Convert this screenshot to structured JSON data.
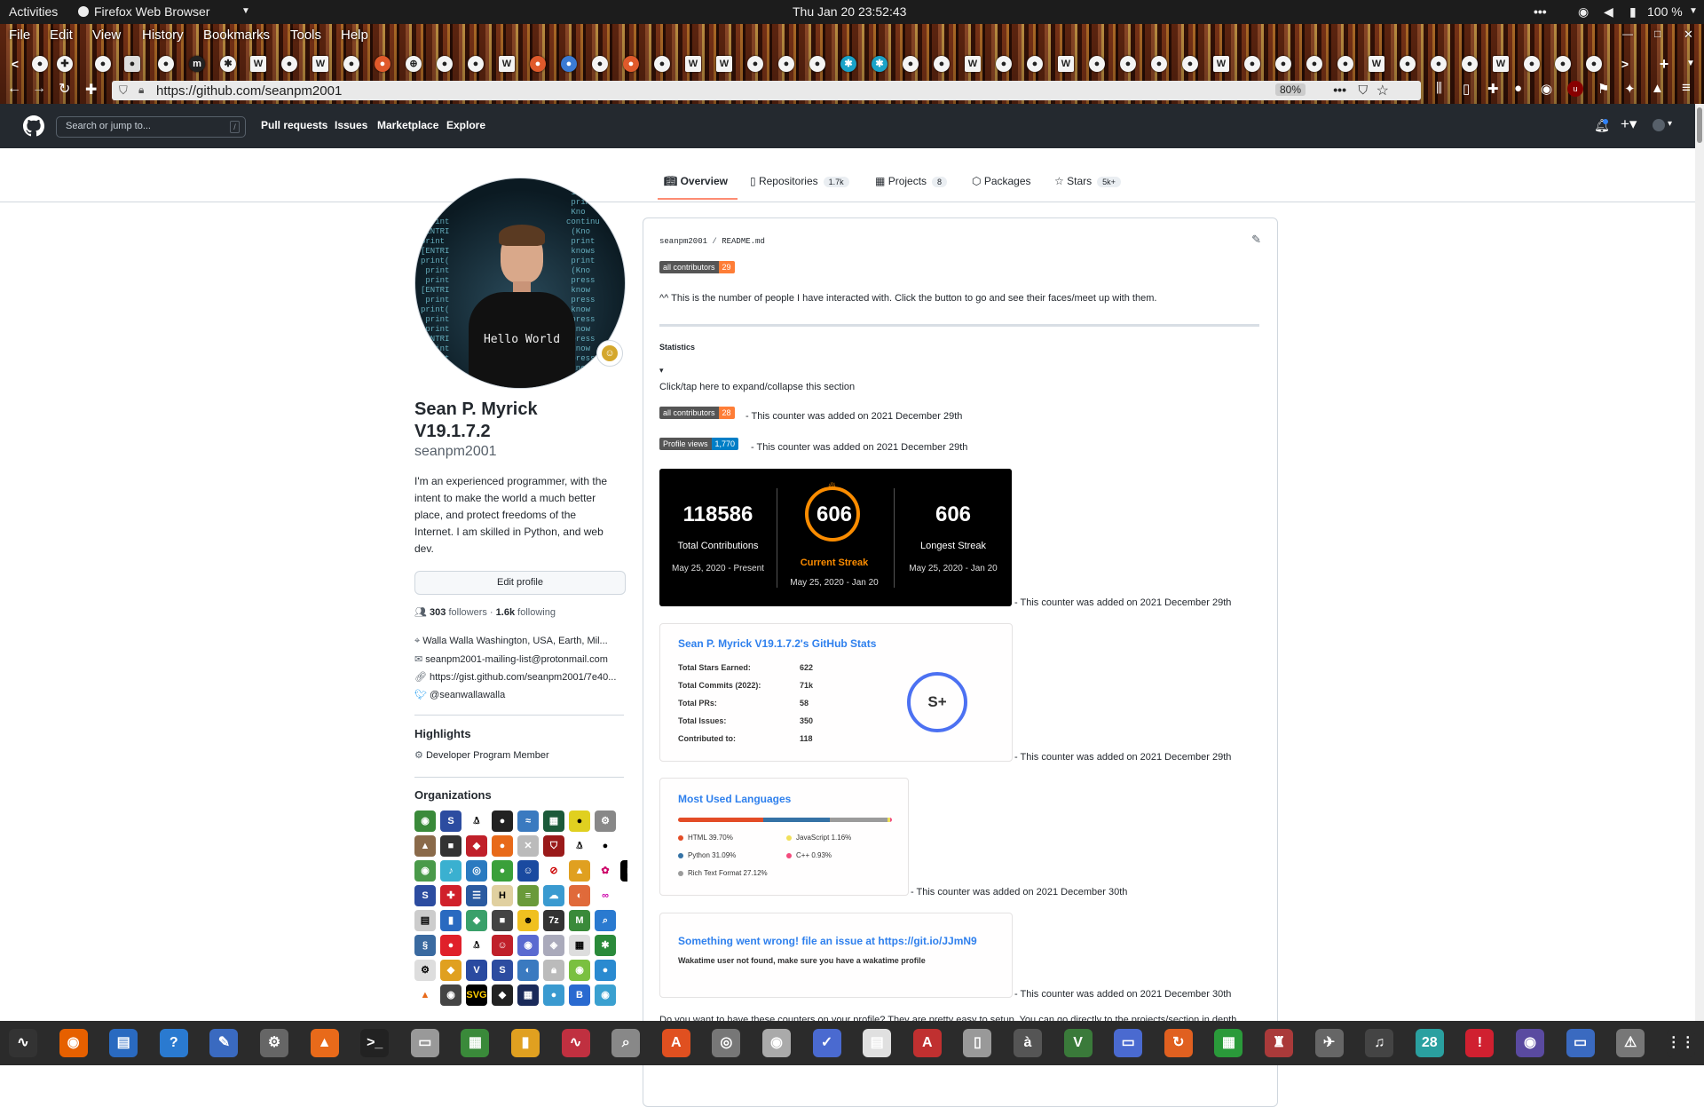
{
  "system_bar": {
    "activities": "Activities",
    "app": "Firefox Web Browser",
    "datetime": "Thu Jan 20  23:52:43",
    "battery": "100 %"
  },
  "browser": {
    "menu": [
      "File",
      "Edit",
      "View",
      "History",
      "Bookmarks",
      "Tools",
      "Help"
    ],
    "url": "https://github.com/seanpm2001",
    "zoom": "80%"
  },
  "github_header": {
    "search_placeholder": "Search or jump to...",
    "search_key": "/",
    "nav": [
      "Pull requests",
      "Issues",
      "Marketplace",
      "Explore"
    ]
  },
  "profile_tabs": [
    {
      "label": "Overview",
      "count": ""
    },
    {
      "label": "Repositories",
      "count": "1.7k"
    },
    {
      "label": "Projects",
      "count": "8"
    },
    {
      "label": "Packages",
      "count": ""
    },
    {
      "label": "Stars",
      "count": "5k+"
    }
  ],
  "profile": {
    "name_line1": "Sean P. Myrick",
    "name_line2": "V19.1.7.2",
    "username": "seanpm2001",
    "bio": "I'm an experienced programmer, with the intent to make the world a much better place, and protect freedoms of the Internet. I am skilled in Python, and web dev.",
    "bio_lines": [
      "I'm an experienced programmer, with the",
      "intent to make the world a much better",
      "place, and protect freedoms of the",
      "Internet. I am skilled in Python, and web",
      "dev."
    ],
    "edit_button": "Edit profile",
    "followers_count": "303",
    "followers_label": "followers",
    "following_count": "1.6k",
    "following_label": "following",
    "location": "Walla Walla Washington, USA, Earth, Mil...",
    "email": "seanpm2001-mailing-list@protonmail.com",
    "website": "https://gist.github.com/seanpm2001/7e40...",
    "twitter": "@seanwallawalla",
    "avatar_shirt_text": "Hello World",
    "highlights_title": "Highlights",
    "highlight_item": "Developer Program Member",
    "organizations_title": "Organizations"
  },
  "readme": {
    "path_user": "seanpm2001",
    "path_sep": "/",
    "path_file": "README.md",
    "badge1": {
      "left": "all contributors",
      "right": "29",
      "color": "#fe7d37"
    },
    "intro": "^^ This is the number of people I have interacted with. Click the button to go and see their faces/meet up with them.",
    "statistics_title": "Statistics",
    "toggle_arrow": "▾",
    "toggle_text": "Click/tap here to expand/collapse this section",
    "badge2": {
      "left": "all contributors",
      "right": "28",
      "color": "#fe7d37"
    },
    "badge3": {
      "left": "Profile views",
      "right": "1,770",
      "color": "#007ec6"
    },
    "note_dec29": "- This counter was added on 2021 December 29th",
    "note_dec30": "- This counter was added on 2021 December 30th",
    "footer_partial": "Do you want to have these counters on your profile? They are pretty easy to setup. You can go directly to the projects/section in depth"
  },
  "streak": {
    "total": "118586",
    "total_label": "Total Contributions",
    "total_range": "May 25, 2020 - Present",
    "current": "606",
    "current_label": "Current Streak",
    "current_range": "May 25, 2020 - Jan 20",
    "longest": "606",
    "longest_label": "Longest Streak",
    "longest_range": "May 25, 2020 - Jan 20",
    "accent": "#fb8c00"
  },
  "stats": {
    "title": "Sean P. Myrick V19.1.7.2's GitHub Stats",
    "rows": [
      {
        "label": "Total Stars Earned:",
        "value": "622"
      },
      {
        "label": "Total Commits (2022):",
        "value": "71k"
      },
      {
        "label": "Total PRs:",
        "value": "58"
      },
      {
        "label": "Total Issues:",
        "value": "350"
      },
      {
        "label": "Contributed to:",
        "value": "118"
      }
    ],
    "rank": "S+",
    "rank_color": "#4c71f2"
  },
  "languages": {
    "title": "Most Used Languages",
    "items": [
      {
        "name": "HTML",
        "percent": 39.7,
        "label": "HTML 39.70%",
        "color": "#e34c26"
      },
      {
        "name": "Python",
        "percent": 31.09,
        "label": "Python 31.09%",
        "color": "#3572A5"
      },
      {
        "name": "Rich Text Format",
        "percent": 27.12,
        "label": "Rich Text Format 27.12%",
        "color": "#9b9b9b"
      },
      {
        "name": "JavaScript",
        "percent": 1.16,
        "label": "JavaScript 1.16%",
        "color": "#f1e05a"
      },
      {
        "name": "C++",
        "percent": 0.93,
        "label": "C++ 0.93%",
        "color": "#f34b7d"
      }
    ]
  },
  "wakatime": {
    "title": "Something went wrong! file an issue at https://git.io/JJmN9",
    "message": "Wakatime user not found, make sure you have a wakatime profile"
  },
  "dock_icons": [
    "system-monitor-icon",
    "firefox-icon",
    "text-editor-icon",
    "help-icon",
    "notes-icon",
    "settings-icon",
    "vlc-icon",
    "terminal-icon",
    "files-icon",
    "spreadsheet-icon",
    "presentation-icon",
    "pulse-icon",
    "search-icon",
    "software-center-icon",
    "disk-icon",
    "ubuntu-icon",
    "tasks-icon",
    "calendar-icon",
    "font-viewer-icon",
    "archive-icon",
    "character-map-icon",
    "vim-icon",
    "screenshot-icon",
    "update-icon",
    "calc-icon",
    "game-icon",
    "bird-icon",
    "music-icon",
    "calendar-28-icon",
    "alert-icon",
    "media-icon",
    "terminal-2-icon",
    "launcher-icon",
    "apps-grid-icon"
  ],
  "dock_calendar_day": "28"
}
